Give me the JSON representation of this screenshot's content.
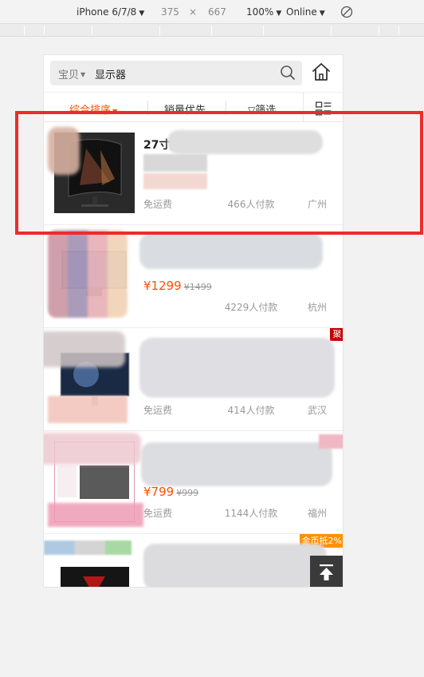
{
  "devtools": {
    "device": "iPhone 6/7/8",
    "width": "375",
    "times": "×",
    "height": "667",
    "zoom": "100%",
    "network": "Online"
  },
  "search": {
    "type_label": "宝贝",
    "query": "显示器"
  },
  "sort": {
    "tabs": [
      "综合排序",
      "销量优先",
      "筛选"
    ]
  },
  "products": [
    {
      "title": "27寸曲",
      "price": "",
      "orig_price": "",
      "shipping": "免运费",
      "sales": "466人付款",
      "location": "广州",
      "badge": ""
    },
    {
      "title": "",
      "price": "¥1299",
      "orig_price": "¥1499",
      "shipping": "",
      "sales": "4229人付款",
      "location": "杭州",
      "badge": ""
    },
    {
      "title": "",
      "price": "",
      "orig_price": "",
      "shipping": "免运费",
      "sales": "414人付款",
      "location": "武汉",
      "badge": "聚"
    },
    {
      "title": "",
      "price": "¥799",
      "orig_price": "¥999",
      "shipping": "免运费",
      "sales": "1144人付款",
      "location": "福州",
      "badge": ""
    },
    {
      "title": "",
      "price": "",
      "orig_price": "",
      "shipping": "",
      "sales": "",
      "location": "",
      "badge": "金币抵2%"
    }
  ],
  "colors": {
    "accent": "#ff5000",
    "highlight": "#ee2b2b",
    "ju_badge": "#c40000",
    "coin_badge": "#ff9000"
  }
}
